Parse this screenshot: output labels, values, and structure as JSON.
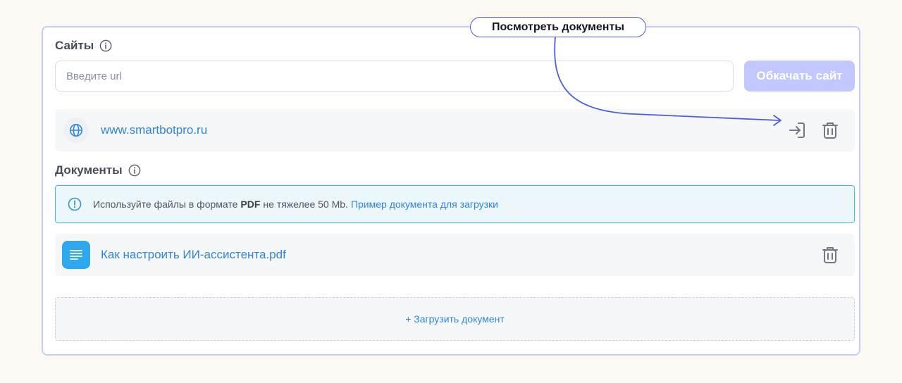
{
  "sites": {
    "label": "Сайты",
    "input_placeholder": "Введите url",
    "input_value": "",
    "crawl_button": "Обкачать сайт",
    "items": [
      {
        "url": "www.smartbotpro.ru",
        "icon": "globe-icon"
      }
    ]
  },
  "documents": {
    "label": "Документы",
    "notice": {
      "prefix": "Используйте файлы в формате",
      "format": "PDF",
      "suffix": "не тяжелее 50 Mb.",
      "link": "Пример документа для загрузки"
    },
    "items": [
      {
        "name": "Как настроить ИИ-ассистента.pdf",
        "icon": "document-icon"
      }
    ],
    "upload_label": "+ Загрузить документ"
  },
  "callout": {
    "label": "Посмотреть документы"
  },
  "colors": {
    "accent": "#4b5ee0",
    "link": "#2f86d6",
    "button_disabled": "#c2c8fd",
    "card_border": "#c6cbfb",
    "notice_border": "#3cc2cf",
    "doc_icon_bg": "#2ea8ee"
  }
}
